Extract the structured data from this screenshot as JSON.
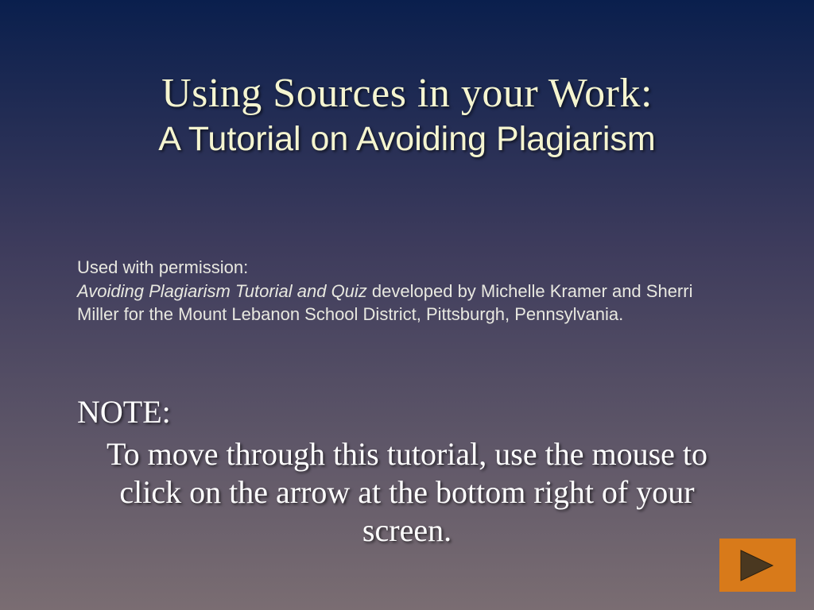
{
  "title": {
    "main": "Using Sources in your Work:",
    "sub": "A Tutorial on Avoiding Plagiarism"
  },
  "permission": {
    "line1": "Used with permission:",
    "italic_part": "Avoiding  Plagiarism Tutorial and Quiz",
    "rest": " developed by Michelle Kramer and Sherri Miller for the  Mount Lebanon School District,  Pittsburgh, Pennsylvania."
  },
  "note": {
    "label": "NOTE:",
    "text": "To move through this tutorial, use the mouse to click on the arrow at the bottom right of your screen."
  }
}
